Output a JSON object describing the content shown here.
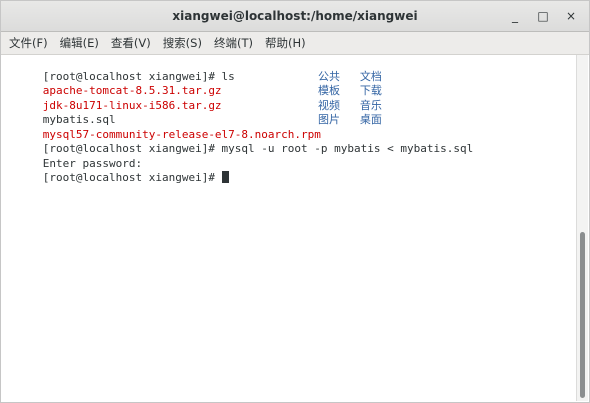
{
  "window": {
    "title": "xiangwei@localhost:/home/xiangwei",
    "controls": {
      "minimize": "_",
      "maximize": "□",
      "close": "×"
    }
  },
  "menu": {
    "items": [
      "文件(F)",
      "编辑(E)",
      "查看(V)",
      "搜索(S)",
      "终端(T)",
      "帮助(H)"
    ]
  },
  "terminal": {
    "lines": [
      {
        "left": "[root@localhost xiangwei]# ls",
        "left_color": "default",
        "right": ""
      },
      {
        "left": "apache-tomcat-8.5.31.tar.gz",
        "left_color": "red",
        "right": "公共   文档"
      },
      {
        "left": "jdk-8u171-linux-i586.tar.gz",
        "left_color": "red",
        "right": "模板   下载"
      },
      {
        "left": "mybatis.sql",
        "left_color": "default",
        "right": "视频   音乐"
      },
      {
        "left": "mysql57-community-release-el7-8.noarch.rpm",
        "left_color": "red",
        "right": "图片   桌面"
      },
      {
        "left": "[root@localhost xiangwei]# mysql -u root -p mybatis < mybatis.sql",
        "left_color": "default",
        "right": ""
      },
      {
        "left": "Enter password:",
        "left_color": "default",
        "right": ""
      },
      {
        "left": "[root@localhost xiangwei]# ",
        "left_color": "default",
        "right": ""
      }
    ]
  },
  "colors": {
    "file_archive": "#cc0000",
    "directory": "#3465a4",
    "text": "#2e3436"
  }
}
